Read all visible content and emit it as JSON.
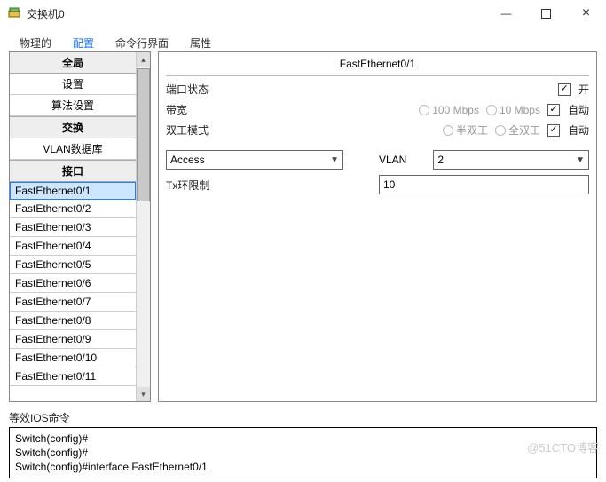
{
  "window": {
    "title": "交换机0"
  },
  "tabs": [
    "物理的",
    "配置",
    "命令行界面",
    "属性"
  ],
  "activeTab": 1,
  "sidebar": {
    "sections": [
      {
        "header": "全局",
        "items": [
          "设置",
          "算法设置"
        ]
      },
      {
        "header": "交换",
        "items": [
          "VLAN数据库"
        ]
      },
      {
        "header": "接口",
        "items": [
          "FastEthernet0/1",
          "FastEthernet0/2",
          "FastEthernet0/3",
          "FastEthernet0/4",
          "FastEthernet0/5",
          "FastEthernet0/6",
          "FastEthernet0/7",
          "FastEthernet0/8",
          "FastEthernet0/9",
          "FastEthernet0/10",
          "FastEthernet0/11"
        ]
      }
    ],
    "selected": "FastEthernet0/1"
  },
  "panel": {
    "title": "FastEthernet0/1",
    "portStatus": {
      "label": "端口状态",
      "on_label": "开",
      "on": true
    },
    "bandwidth": {
      "label": "带宽",
      "opt1": "100 Mbps",
      "opt2": "10 Mbps",
      "auto_label": "自动",
      "auto": true
    },
    "duplex": {
      "label": "双工模式",
      "opt1": "半双工",
      "opt2": "全双工",
      "auto_label": "自动",
      "auto": true
    },
    "mode": {
      "value": "Access",
      "vlan_label": "VLAN",
      "vlan_value": "2"
    },
    "txring": {
      "label": "Tx环限制",
      "value": "10"
    }
  },
  "ios": {
    "label": "等效IOS命令",
    "lines": [
      "Switch(config)#",
      "Switch(config)#",
      "Switch(config)#interface FastEthernet0/1"
    ]
  },
  "watermark": "@51CTO博客"
}
